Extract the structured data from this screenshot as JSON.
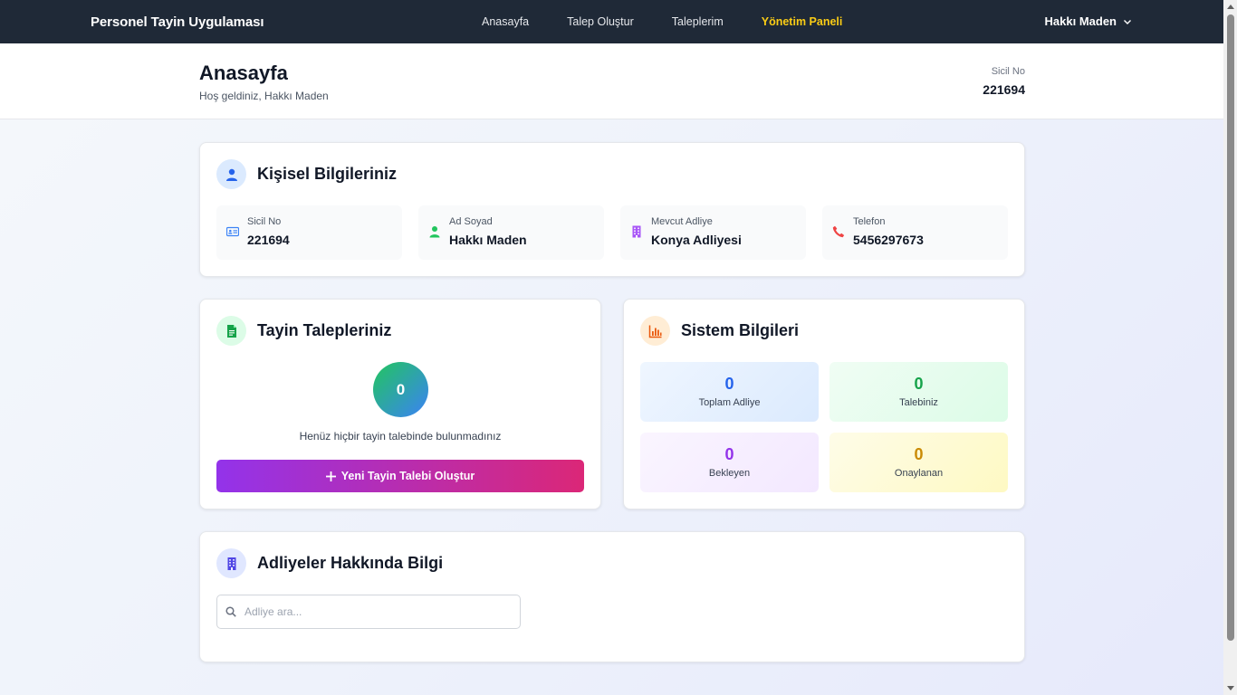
{
  "app": {
    "title": "Personel Tayin Uygulaması"
  },
  "nav": {
    "items": [
      {
        "label": "Anasayfa"
      },
      {
        "label": "Talep Oluştur"
      },
      {
        "label": "Taleplerim"
      },
      {
        "label": "Yönetim Paneli",
        "active": true
      }
    ],
    "user_name": "Hakkı Maden"
  },
  "header": {
    "title": "Anasayfa",
    "subtitle": "Hoş geldiniz, Hakkı Maden",
    "sicil_label": "Sicil No",
    "sicil_value": "221694"
  },
  "personal": {
    "title": "Kişisel Bilgileriniz",
    "fields": [
      {
        "label": "Sicil No",
        "value": "221694",
        "icon": "id-card-icon",
        "color": "#3b82f6"
      },
      {
        "label": "Ad Soyad",
        "value": "Hakkı Maden",
        "icon": "user-icon",
        "color": "#22c55e"
      },
      {
        "label": "Mevcut Adliye",
        "value": "Konya Adliyesi",
        "icon": "building-icon",
        "color": "#a855f7"
      },
      {
        "label": "Telefon",
        "value": "5456297673",
        "icon": "phone-icon",
        "color": "#ef4444"
      }
    ]
  },
  "requests": {
    "title": "Tayin Talepleriniz",
    "count": "0",
    "empty_text": "Henüz hiçbir tayin talebinde bulunmadınız",
    "button_label": "Yeni Tayin Talebi Oluştur"
  },
  "system": {
    "title": "Sistem Bilgileri",
    "stats": [
      {
        "value": "0",
        "label": "Toplam Adliye",
        "color": "#2563eb"
      },
      {
        "value": "0",
        "label": "Talebiniz",
        "color": "#16a34a"
      },
      {
        "value": "0",
        "label": "Bekleyen",
        "color": "#9333ea"
      },
      {
        "value": "0",
        "label": "Onaylanan",
        "color": "#ca8a04"
      }
    ]
  },
  "courthouses": {
    "title": "Adliyeler Hakkında Bilgi",
    "search_placeholder": "Adliye ara..."
  },
  "colors": {
    "navbar": "#1f2937",
    "active_nav": "#facc15",
    "button_gradient_start": "#9333ea",
    "button_gradient_end": "#db2777"
  }
}
